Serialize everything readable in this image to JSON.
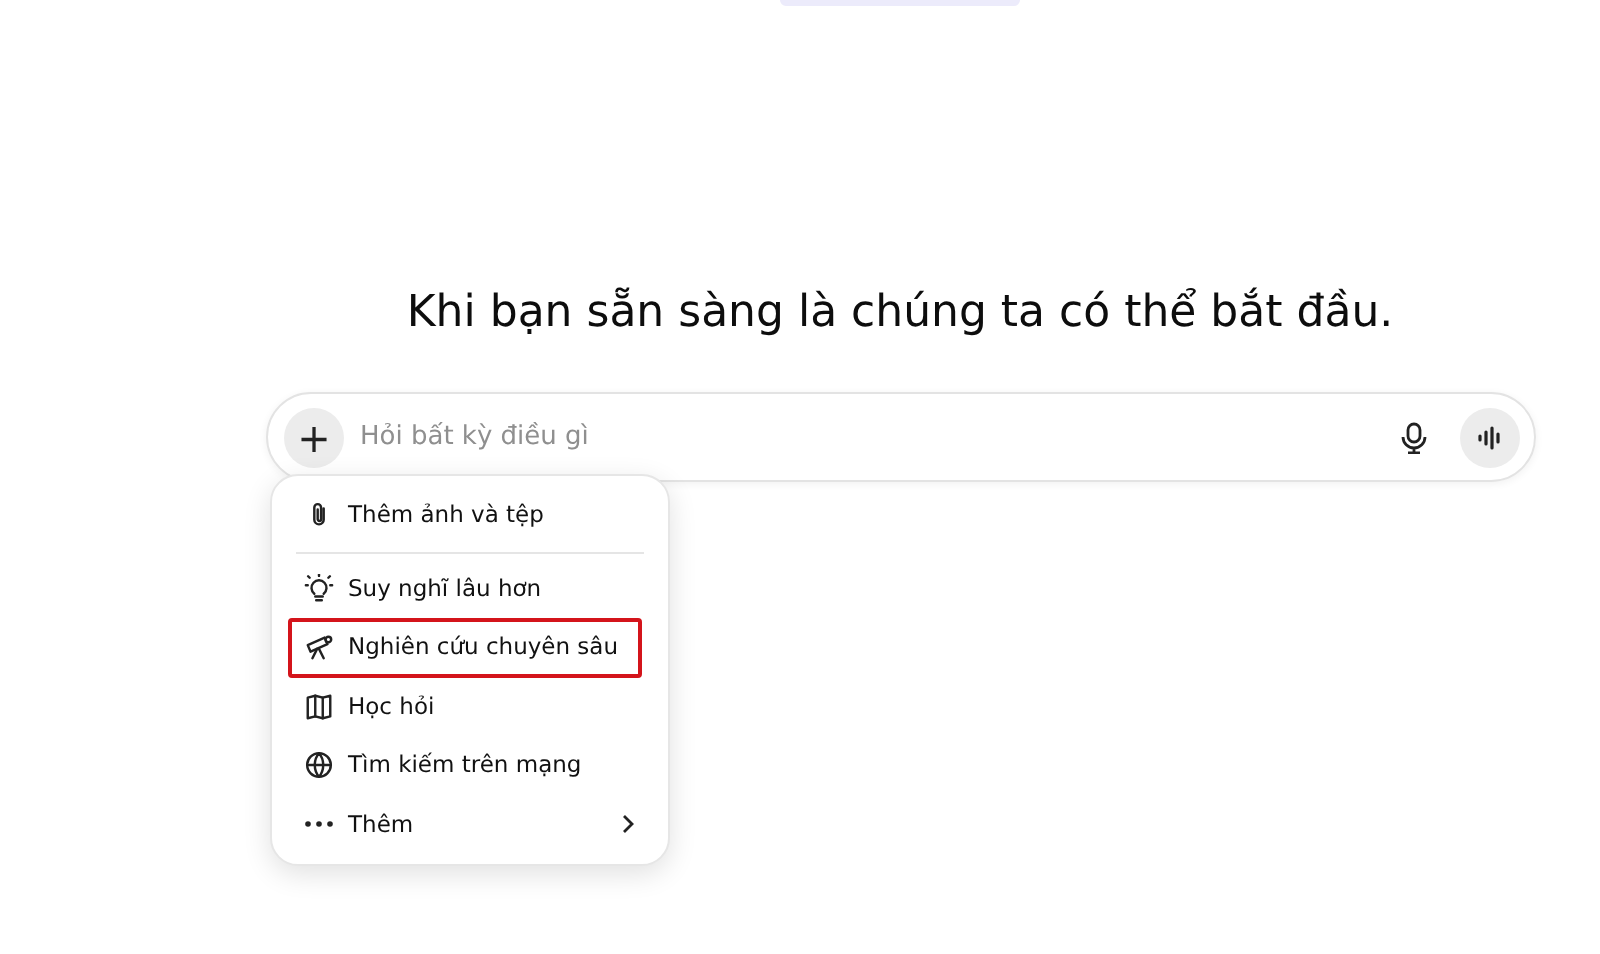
{
  "heading": "Khi bạn sẵn sàng là chúng ta có thể bắt đầu.",
  "composer": {
    "placeholder": "Hỏi bất kỳ điều gì",
    "plus": "+"
  },
  "menu": {
    "sections": [
      [
        {
          "label": "Thêm ảnh và tệp",
          "highlighted": false,
          "submenu": false
        }
      ],
      [
        {
          "label": "Suy nghĩ lâu hơn",
          "highlighted": false,
          "submenu": false
        },
        {
          "label": "Nghiên cứu chuyên sâu",
          "highlighted": true,
          "submenu": false
        },
        {
          "label": "Học hỏi",
          "highlighted": false,
          "submenu": false
        },
        {
          "label": "Tìm kiếm trên mạng",
          "highlighted": false,
          "submenu": false
        },
        {
          "label": "Thêm",
          "highlighted": false,
          "submenu": true
        }
      ]
    ]
  }
}
